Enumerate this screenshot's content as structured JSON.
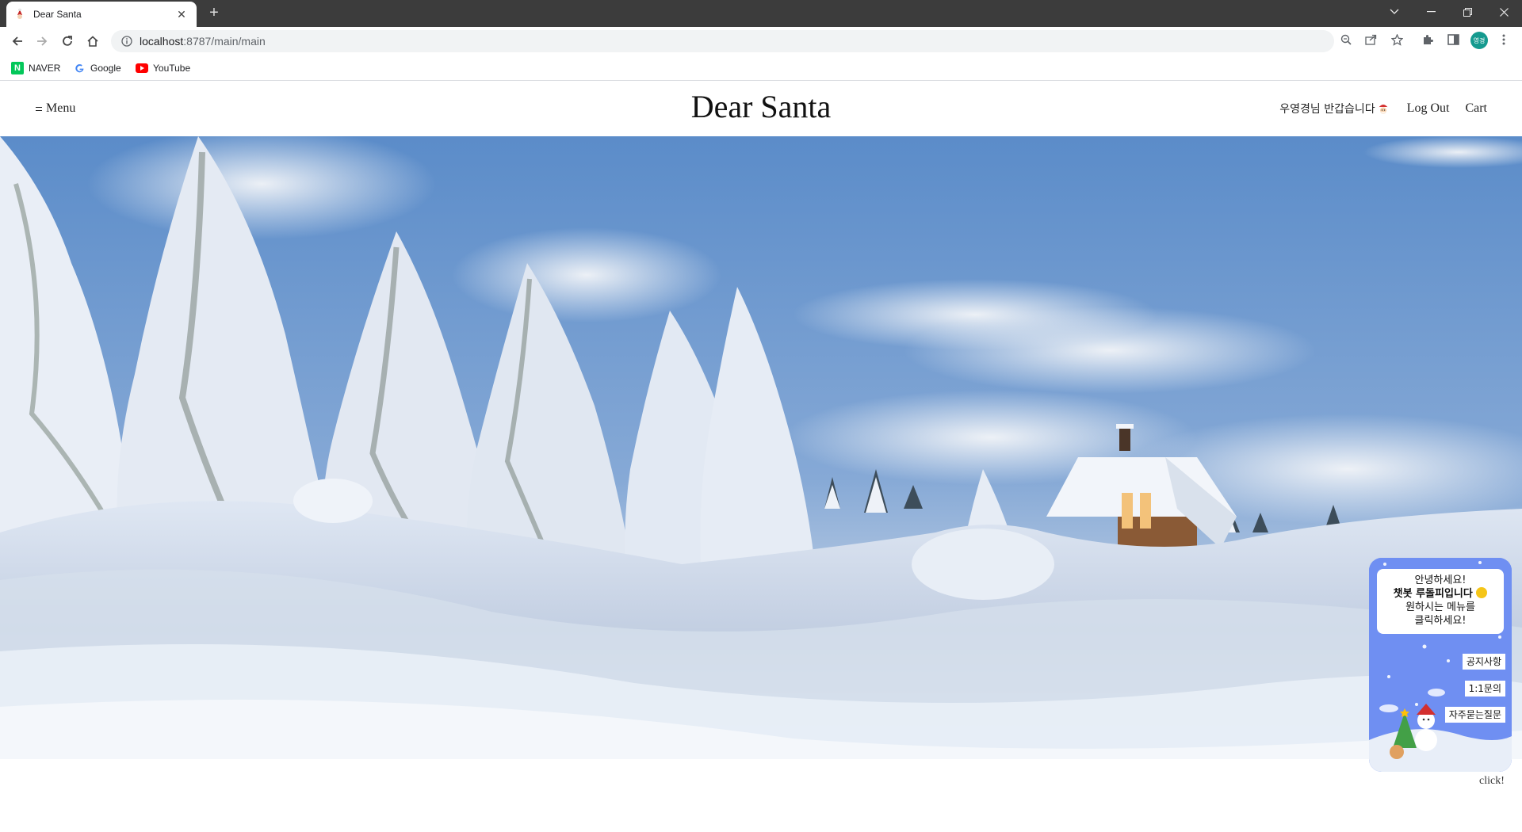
{
  "browser": {
    "tab_title": "Dear Santa",
    "url_host": "localhost",
    "url_path": ":8787/main/main",
    "profile_initials": "영경",
    "bookmarks": [
      {
        "label": "NAVER",
        "icon": "naver-icon",
        "color": "#03c75a"
      },
      {
        "label": "Google",
        "icon": "google-icon",
        "color": "#4285f4"
      },
      {
        "label": "YouTube",
        "icon": "youtube-icon",
        "color": "#ff0000"
      }
    ]
  },
  "header": {
    "menu_label": "Menu",
    "site_title": "Dear Santa",
    "greeting": "우영경님 반갑습니다",
    "logout_label": "Log Out",
    "cart_label": "Cart"
  },
  "hero": {
    "scene": "snowy-forest-cabin",
    "sky_color": "#5f8fcd",
    "snow_color": "#e6eef8"
  },
  "chatbot": {
    "greeting_line1": "안녕하세요!",
    "greeting_line2": "챗봇 루돌피입니다",
    "greeting_line3": "원하시는 메뉴를",
    "greeting_line4": "클릭하세요!",
    "buttons": [
      "공지사항",
      "1:1문의",
      "자주묻는질문"
    ],
    "click_label": "click!",
    "bg_color": "#6d8ff0"
  }
}
